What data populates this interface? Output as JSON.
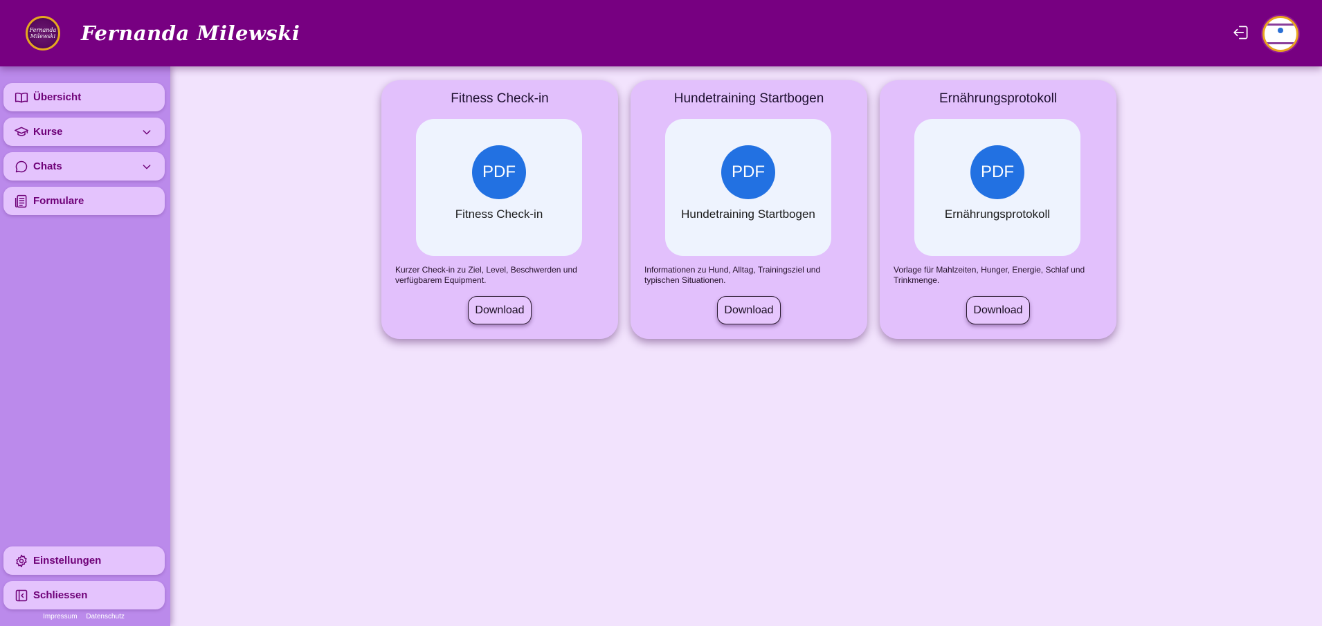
{
  "header": {
    "logo_text": "Fernanda Milewski",
    "brand": "Fernanda Milewski"
  },
  "colors": {
    "header": "#770081",
    "sidebar": "#bb8aeb",
    "nav_item": "#e4c3fd",
    "card": "#e2c0fc",
    "pdf_badge": "#2271e2",
    "page_bg": "#f2e3fd"
  },
  "sidebar": {
    "items": [
      {
        "label": "Übersicht",
        "icon": "book-open-icon"
      },
      {
        "label": "Kurse",
        "icon": "graduation-cap-icon"
      },
      {
        "label": "Chats",
        "icon": "chat-bubble-icon"
      },
      {
        "label": "Formulare",
        "icon": "document-list-icon"
      }
    ],
    "bottom": [
      {
        "label": "Einstellungen",
        "icon": "gear-icon"
      },
      {
        "label": "Schliessen",
        "icon": "panel-collapse-icon"
      }
    ],
    "footer": {
      "impressum": "Impressum",
      "datenschutz": "Datenschutz"
    }
  },
  "forms": [
    {
      "title": "Fitness Check-in",
      "badge": "PDF",
      "preview_name": "Fitness Check-in",
      "description": "Kurzer Check-in zu Ziel, Level, Beschwerden und verfügbarem Equipment.",
      "button": "Download"
    },
    {
      "title": "Hundetraining Startbogen",
      "badge": "PDF",
      "preview_name": "Hundetraining Startbogen",
      "description": "Informationen zu Hund, Alltag, Trainingsziel und typischen Situationen.",
      "button": "Download"
    },
    {
      "title": "Ernährungsprotokoll",
      "badge": "PDF",
      "preview_name": "Ernährungsprotokoll",
      "description": "Vorlage für Mahlzeiten, Hunger, Energie, Schlaf und Trinkmenge.",
      "button": "Download"
    }
  ]
}
